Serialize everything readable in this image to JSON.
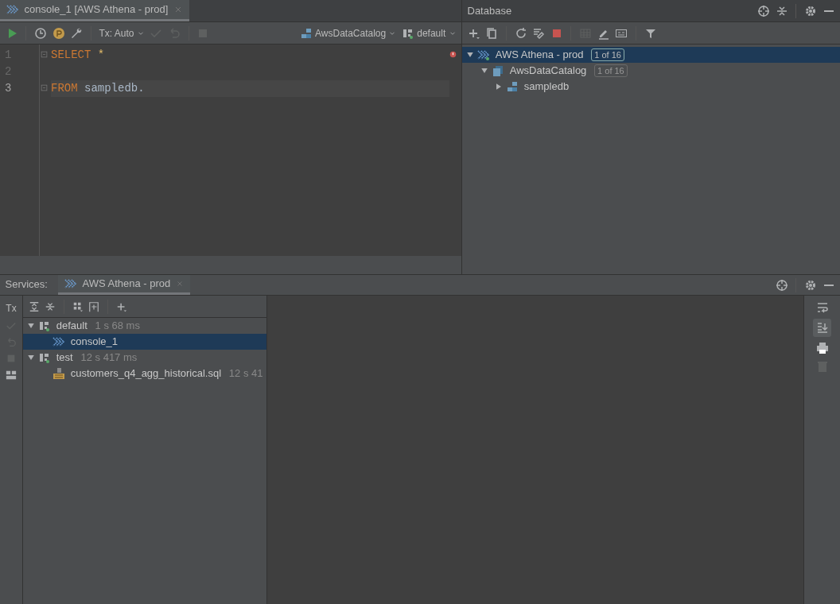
{
  "editor_tab": {
    "title": "console_1 [AWS Athena - prod]",
    "selected": true
  },
  "editor_toolbar": {
    "tx_mode": "Tx: Auto",
    "catalog": "AwsDataCatalog",
    "schema": "default"
  },
  "editor": {
    "lines": [
      {
        "number": "1",
        "current": false,
        "code": [
          {
            "text": "SELECT",
            "kind": "keyword"
          },
          {
            "text": " *",
            "kind": "operator"
          }
        ]
      },
      {
        "number": "2",
        "current": false
      },
      {
        "number": "3",
        "current": true,
        "code": [
          {
            "text": "FROM",
            "kind": "keyword"
          },
          {
            "text": " sampledb.",
            "kind": "plain"
          }
        ]
      }
    ]
  },
  "database": {
    "title": "Database",
    "tree": [
      {
        "label": "AWS Athena - prod",
        "badge": "1 of 16",
        "kind": "connection",
        "expanded": true,
        "selected": true,
        "children": [
          {
            "label": "AwsDataCatalog",
            "badge": "1 of 16",
            "kind": "catalog",
            "expanded": true,
            "selected": false,
            "children": [
              {
                "label": "sampledb",
                "kind": "schema",
                "expanded": false,
                "selected": false
              }
            ]
          }
        ]
      }
    ]
  },
  "services": {
    "label": "Services:",
    "tab": {
      "title": "AWS Athena - prod",
      "selected": true
    },
    "tx_label": "Tx",
    "tree": [
      {
        "label": "default",
        "timing": "1 s 68 ms",
        "kind": "session",
        "expanded": true,
        "selected": false,
        "children": [
          {
            "label": "console_1",
            "kind": "console",
            "selected": true
          }
        ]
      },
      {
        "label": "test",
        "timing": "12 s 417 ms",
        "kind": "session",
        "expanded": true,
        "selected": false,
        "children": [
          {
            "label": "customers_q4_agg_historical.sql",
            "timing": "12 s 41",
            "kind": "file",
            "selected": false
          }
        ]
      }
    ]
  }
}
